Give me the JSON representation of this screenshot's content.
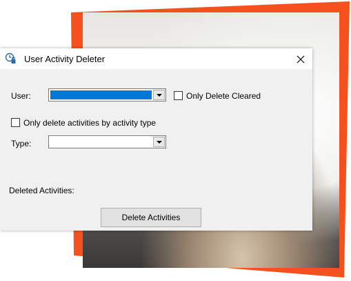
{
  "window": {
    "title": "User Activity Deleter"
  },
  "form": {
    "user_label": "User:",
    "only_cleared_label": "Only Delete Cleared",
    "by_type_label": "Only delete activities by activity type",
    "type_label": "Type:",
    "deleted_label": "Deleted Activities:",
    "delete_button": "Delete Activities"
  },
  "colors": {
    "accent": "#f4511e",
    "selection": "#0078d7",
    "dialog_bg": "#f0f0f0"
  },
  "icons": {
    "app": "clock-lock-icon",
    "close": "close-icon",
    "dropdown": "chevron-down-icon"
  }
}
